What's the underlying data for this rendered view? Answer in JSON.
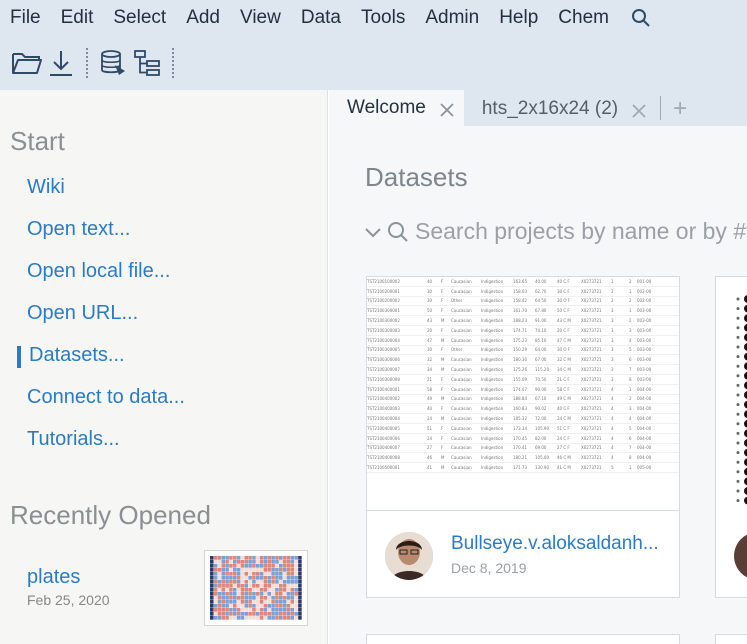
{
  "menubar": {
    "items": [
      "File",
      "Edit",
      "Select",
      "Add",
      "View",
      "Data",
      "Tools",
      "Admin",
      "Help",
      "Chem"
    ],
    "search_icon": "search-icon"
  },
  "toolbar": {
    "icons": [
      "folder-open-icon",
      "download-icon",
      "database-icon",
      "tree-icon"
    ]
  },
  "left_panel": {
    "start_title": "Start",
    "links": [
      "Wiki",
      "Open text...",
      "Open local file...",
      "Open URL...",
      "Datasets...",
      "Connect to data...",
      "Tutorials..."
    ],
    "active_link": "Datasets...",
    "recent_title": "Recently Opened",
    "recent": [
      {
        "name": "plates",
        "date": "Feb 25, 2020"
      }
    ]
  },
  "tabs": [
    {
      "label": "Welcome",
      "active": true
    },
    {
      "label": "hts_2x16x24 (2)",
      "active": false
    }
  ],
  "tab_add": "+",
  "content": {
    "title": "Datasets",
    "search_placeholder": "Search projects by name or by #tags"
  },
  "cards": [
    {
      "name": "Bullseye.v.aloksaldanh...",
      "date": "Dec 8, 2019"
    }
  ],
  "preview_rows": [
    [
      "TST2100100002",
      "40",
      "F",
      "Caucasian",
      "Indigestion",
      "163.65",
      "40.00",
      "40 C F",
      "X0273721",
      "1",
      "2",
      "001-00"
    ],
    [
      "TST2100200001",
      "30",
      "F",
      "Caucasian",
      "Indigestion",
      "158.03",
      "62.70",
      "30 C F",
      "X0273721",
      "2",
      "1",
      "002-00"
    ],
    [
      "TST2100200002",
      "30",
      "F",
      "Other",
      "Indigestion",
      "158.42",
      "64.50",
      "30 O F",
      "X0273721",
      "2",
      "2",
      "002-00"
    ],
    [
      "TST2100300001",
      "50",
      "F",
      "Caucasian",
      "Indigestion",
      "161.70",
      "67.80",
      "50 C F",
      "X0273721",
      "3",
      "1",
      "003-00"
    ],
    [
      "TST2100300002",
      "43",
      "M",
      "Caucasian",
      "Indigestion",
      "188.23",
      "91.00",
      "43 C M",
      "X0273721",
      "3",
      "2",
      "003-00"
    ],
    [
      "TST2100300003",
      "20",
      "F",
      "Caucasian",
      "Indigestion",
      "174.71",
      "74.10",
      "20 C F",
      "X0273721",
      "3",
      "3",
      "003-00"
    ],
    [
      "TST2100300004",
      "47",
      "M",
      "Caucasian",
      "Indigestion",
      "175.23",
      "85.10",
      "47 C M",
      "X0273721",
      "3",
      "4",
      "003-00"
    ],
    [
      "TST2100300005",
      "30",
      "F",
      "Other",
      "Indigestion",
      "150.29",
      "64.00",
      "30 O F",
      "X0273721",
      "3",
      "5",
      "003-00"
    ],
    [
      "TST2100300006",
      "32",
      "M",
      "Caucasian",
      "Indigestion",
      "180.30",
      "67.00",
      "32 C M",
      "X0273721",
      "3",
      "6",
      "003-00"
    ],
    [
      "TST2100300007",
      "34",
      "M",
      "Caucasian",
      "Indigestion",
      "175.26",
      "115.20",
      "34 C M",
      "X0273721",
      "3",
      "7",
      "003-00"
    ],
    [
      "TST2100300008",
      "21",
      "F",
      "Caucasian",
      "Indigestion",
      "155.09",
      "70.50",
      "21 C F",
      "X0273721",
      "3",
      "8",
      "003-00"
    ],
    [
      "TST2100400001",
      "58",
      "F",
      "Caucasian",
      "Indigestion",
      "174.07",
      "90.00",
      "58 C F",
      "X0273721",
      "4",
      "1",
      "004-00"
    ],
    [
      "TST2100400002",
      "49",
      "M",
      "Caucasian",
      "Indigestion",
      "188.84",
      "67.10",
      "49 C M",
      "X0273721",
      "4",
      "2",
      "004-00"
    ],
    [
      "TST2100400003",
      "40",
      "F",
      "Caucasian",
      "Indigestion",
      "160.83",
      "90.02",
      "40 C F",
      "X0273721",
      "4",
      "3",
      "004-00"
    ],
    [
      "TST2100400004",
      "24",
      "M",
      "Caucasian",
      "Indigestion",
      "185.32",
      "72.00",
      "24 C M",
      "X0273721",
      "4",
      "4",
      "004-00"
    ],
    [
      "TST2100400005",
      "51",
      "F",
      "Caucasian",
      "Indigestion",
      "173.34",
      "105.90",
      "51 C F",
      "X0273721",
      "4",
      "5",
      "004-00"
    ],
    [
      "TST2100400006",
      "24",
      "F",
      "Caucasian",
      "Indigestion",
      "170.45",
      "82.00",
      "24 C F",
      "X0273721",
      "4",
      "6",
      "004-00"
    ],
    [
      "TST2100400007",
      "27",
      "F",
      "Caucasian",
      "Indigestion",
      "170.41",
      "69.00",
      "27 C F",
      "X0273721",
      "4",
      "7",
      "004-00"
    ],
    [
      "TST2100400008",
      "46",
      "M",
      "Caucasian",
      "Indigestion",
      "180.21",
      "105.00",
      "46 C M",
      "X0273721",
      "4",
      "8",
      "004-00"
    ],
    [
      "TST2100500001",
      "41",
      "M",
      "Caucasian",
      "Indigestion",
      "171.73",
      "130.90",
      "41 C M",
      "X0273721",
      "5",
      "1",
      "005-00"
    ]
  ],
  "colors": {
    "link": "#2a7bc3",
    "menubar_bg": "#dee6ef",
    "panel_bg": "#f6f6f4",
    "content_bg": "#f6f7f9",
    "heatmap_hot": "#e0857a",
    "heatmap_cold": "#7aa0d6"
  }
}
